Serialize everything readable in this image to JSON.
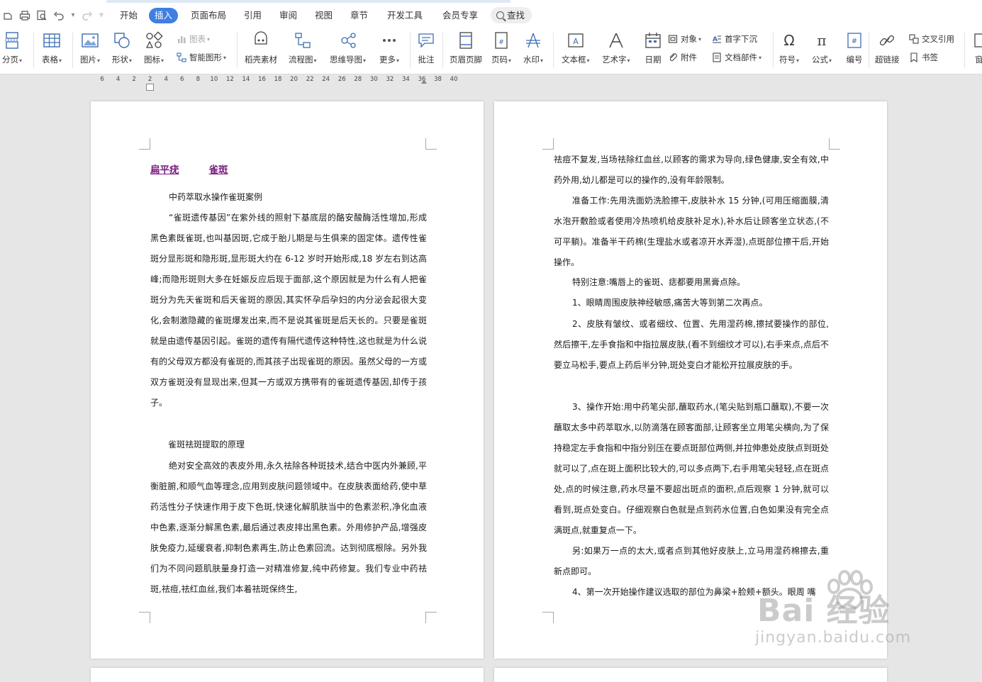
{
  "menubar": {
    "tabs": [
      "开始",
      "插入",
      "页面布局",
      "引用",
      "审阅",
      "视图",
      "章节",
      "开发工具",
      "会员专享"
    ],
    "active_tab": "插入",
    "search_label": "查找"
  },
  "ribbon": {
    "page_break": "分页",
    "table": "表格",
    "picture": "图片",
    "shape": "形状",
    "icon": "图标",
    "chart": "图表",
    "smart_graphic": "智能图形",
    "docer_material": "稻壳素材",
    "flowchart": "流程图",
    "mindmap": "思维导图",
    "more": "更多",
    "comment": "批注",
    "header_footer": "页眉页脚",
    "page_number": "页码",
    "watermark": "水印",
    "text_box": "文本框",
    "word_art": "艺术字",
    "date": "日期",
    "object": "对象",
    "attachment": "附件",
    "drop_cap": "首字下沉",
    "doc_parts": "文档部件",
    "symbol": "符号",
    "formula": "公式",
    "numbering": "编号",
    "hyperlink": "超链接",
    "cross_ref": "交叉引用",
    "bookmark": "书签",
    "window_partial": "窗"
  },
  "ruler": {
    "labels": [
      "6",
      "4",
      "2",
      "2",
      "4",
      "6",
      "8",
      "10",
      "12",
      "14",
      "16",
      "18",
      "20",
      "22",
      "24",
      "26",
      "28",
      "30",
      "32",
      "34",
      "36",
      "38",
      "40"
    ]
  },
  "document": {
    "page1": {
      "links": [
        "扁平疣",
        "雀斑"
      ],
      "paragraphs": [
        "中药萃取水操作雀斑案例",
        "“雀斑遗传基因”在紫外线的照射下基底层的酪安酸酶活性增加,形成黑色素既雀斑,也叫基因斑,它成于胎儿期是与生俱来的固定体。遗传性雀斑分显形斑和隐形斑,显形斑大约在 6-12 岁时开始形成,18 岁左右到达高峰;而隐形斑则大多在妊娠反应后现于面部,这个原因就是为什么有人把雀斑分为先天雀斑和后天雀斑的原因,其实怀孕后孕妇的内分泌会起很大变化,会制激隐藏的雀斑爆发出来,而不是说其雀斑是后天长的。只要是雀斑就是由遗传基因引起。雀斑的遗传有隔代遗传这种特性,这也就是为什么说有的父母双方都没有雀斑的,而其孩子出现雀斑的原因。虽然父母的一方或双方雀斑没有显现出来,但其一方或双方携带有的雀斑遗传基因,却传于孩子。",
        "雀斑祛斑提取的原理",
        "绝对安全高效的表皮外用,永久祛除各种斑技术,结合中医内外兼顾,平衡脏腑,和顺气血等理念,应用到皮肤问题领域中。在皮肤表面给药,使中草药活性分子快速作用于皮下色斑,快速化解肌肤当中的色素淤积,净化血液中色素,逐渐分解黑色素,最后通过表皮排出黑色素。外用修护产品,增强皮肤免疫力,延缓衰者,抑制色素再生,防止色素回流。达到彻底根除。另外我们为不同问题肌肤量身打造一对精准修复,纯中药修复。我们专业中药祛斑,祛痘,祛红血丝,我们本着祛斑保终生,"
      ]
    },
    "page2": {
      "paragraphs": [
        "祛痘不复发,当场祛除红血丝,以顾客的需求为导向,绿色健康,安全有效,中药外用,幼儿都是可以的操作的,没有年龄限制。",
        "准备工作:先用洗面奶洗脸擦干,皮肤补水 15 分钟,(可用压缩面膜,清水泡开敷脸或者使用冷热喷机给皮肤补足水),补水后让顾客坐立状态,(不可平躺)。准备半干药棉(生理盐水或者凉开水弄湿),点斑部位擦干后,开始操作。",
        "特别注意:嘴唇上的雀斑、痣都要用黑膏点除。",
        "1、眼睛周围皮肤神经敏感,痛苦大等到第二次再点。",
        "2、皮肤有皱纹、或者细纹、位置、先用湿药棉,擦拭要操作的部位,然后擦干,左手食指和中指拉展皮肤,(看不到细纹才可以),右手来点,点后不要立马松手,要点上药后半分钟,斑处变白才能松开拉展皮肤的手。",
        "3、操作开始:用中药笔尖部,蘸取药水,(笔尖贴到瓶口蘸取),不要一次蘸取太多中药萃取水,以防滴落在顾客面部,让顾客坐立用笔尖横向,为了保持稳定左手食指和中指分别压在要点斑部位两侧,并拉伸患处皮肤点到斑处就可以了,点在斑上面积比较大的,可以多点两下,右手用笔尖轻轻,点在斑点处,点的时候注意,药水尽量不要超出斑点的面积,点后观察 1 分钟,就可以看到,斑点处变白。仔细观察白色就是点到药水位置,白色如果没有完全点满斑点,就重复点一下。",
        "另:如果万一点的太大,或者点到其他好皮肤上,立马用湿药棉擦去,重新点即可。",
        "4、第一次开始操作建议选取的部位为鼻梁+脸颊+额头。眼周 嘴"
      ]
    }
  },
  "watermark": {
    "logo_text": "Bai 经验",
    "url": "jingyan.baidu.com"
  }
}
